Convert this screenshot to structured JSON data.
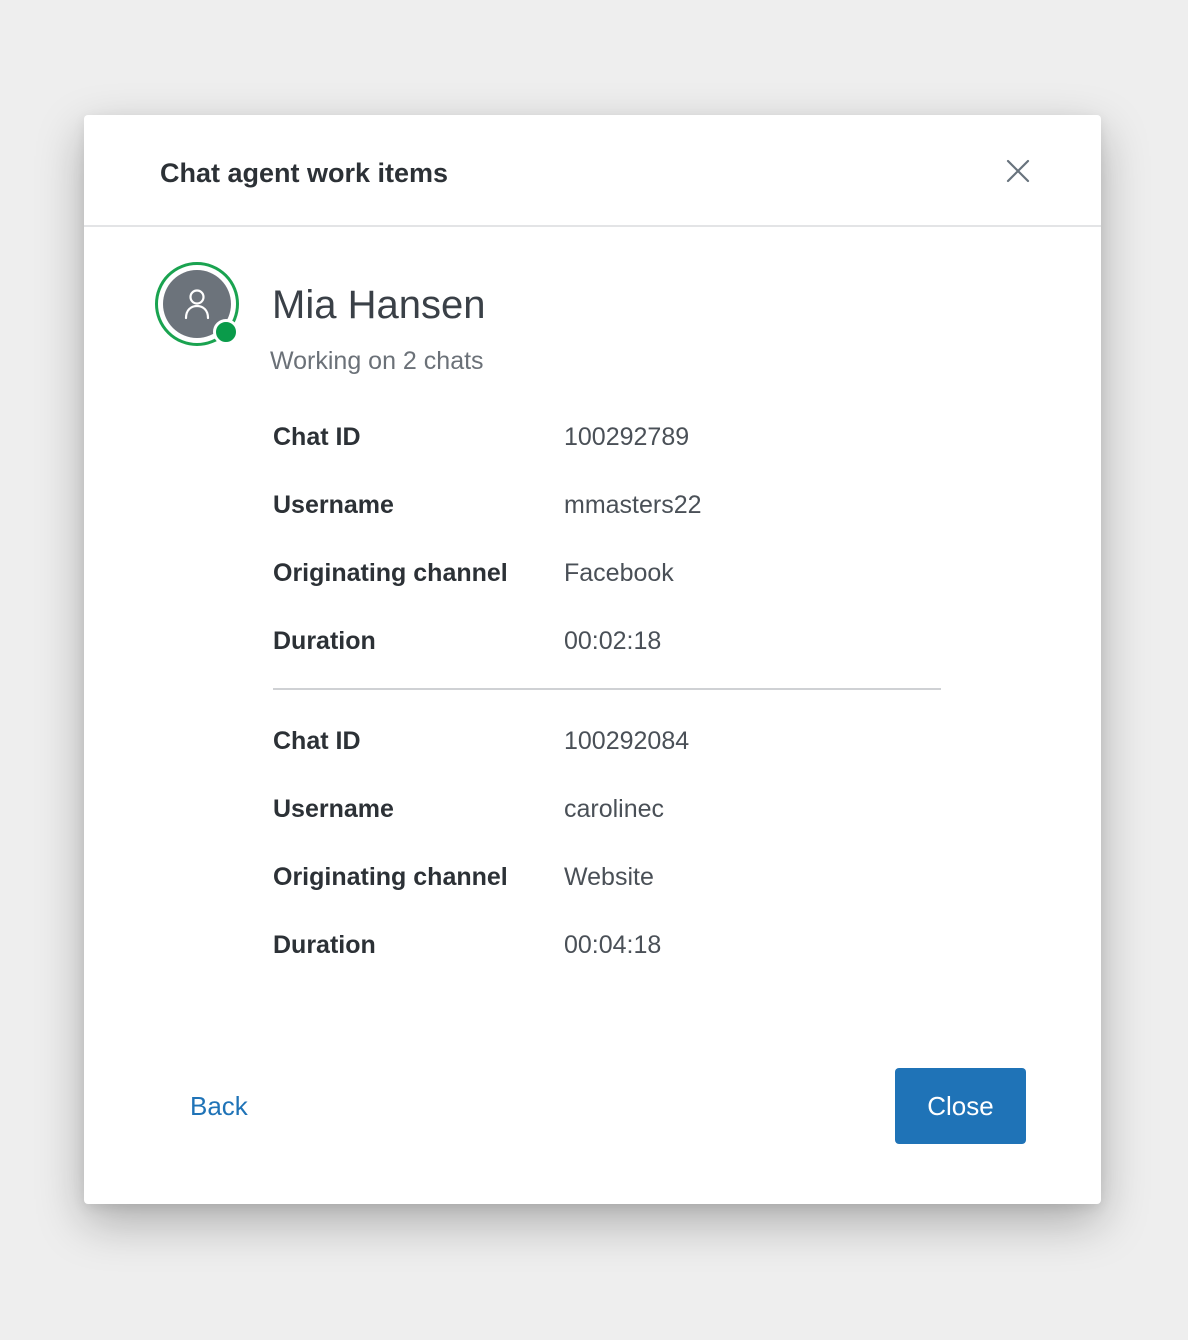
{
  "modal": {
    "title": "Chat agent work items",
    "close_icon": "close-icon"
  },
  "agent": {
    "avatar_icon": "user-icon",
    "name": "Mia Hansen",
    "status_text": "Working on 2 chats",
    "status_color": "#0a9b4a",
    "ring_color": "#1aa350"
  },
  "chats": [
    {
      "fields": [
        {
          "label": "Chat ID",
          "value": "100292789"
        },
        {
          "label": "Username",
          "value": "mmasters22"
        },
        {
          "label": "Originating channel",
          "value": "Facebook"
        },
        {
          "label": "Duration",
          "value": "00:02:18"
        }
      ]
    },
    {
      "fields": [
        {
          "label": "Chat ID",
          "value": "100292084"
        },
        {
          "label": "Username",
          "value": "carolinec"
        },
        {
          "label": "Originating channel",
          "value": "Website"
        },
        {
          "label": "Duration",
          "value": "00:04:18"
        }
      ]
    }
  ],
  "footer": {
    "back_label": "Back",
    "close_label": "Close"
  },
  "colors": {
    "accent": "#1f73b7",
    "background": "#eeeeee"
  }
}
